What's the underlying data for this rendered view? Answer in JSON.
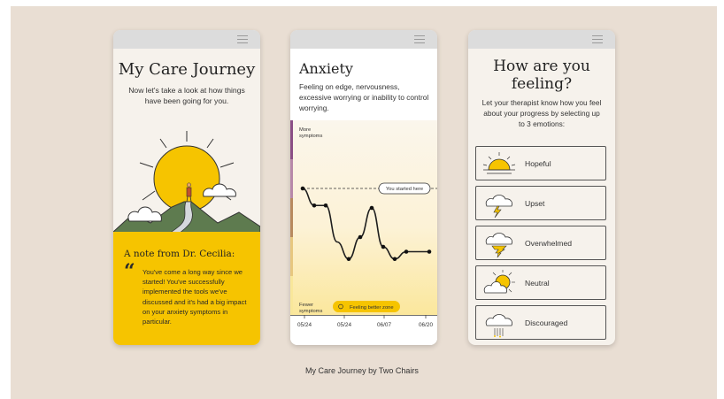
{
  "screen1": {
    "title": "My Care Journey",
    "subtitle": "Now let's take a look at how things have been going for you.",
    "note_title": "A note from Dr. Cecilia:",
    "note_body": "You've come a long way since we started! You've successfully implemented the tools we've discussed and it's had a big impact on your anxiety symptoms in particular.",
    "quote_mark": "“"
  },
  "screen2": {
    "title": "Anxiety",
    "subtitle": "Feeling on edge, nervousness, excessive worrying or inability to control worrying.",
    "more_label": "More symptoms",
    "fewer_label": "Fewer symptoms",
    "started_label": "You started here",
    "zone_label": "Feeling better zone"
  },
  "chart_data": {
    "type": "line",
    "x_ticks": [
      "05/24",
      "05/24",
      "06/07",
      "06/20"
    ],
    "values": [
      3.6,
      3.25,
      3.25,
      2.5,
      2.15,
      2.6,
      3.2,
      2.4,
      2.15,
      2.3,
      2.3,
      2.3
    ],
    "ylim": [
      1,
      5
    ],
    "start_value": 3.6,
    "bands": [
      "#8b4f86",
      "#b889a9",
      "#b88a5e",
      "#e7c77f",
      "#f9e79a"
    ],
    "title": "Anxiety",
    "xlabel": "",
    "ylabel": ""
  },
  "screen3": {
    "title": "How are you feeling?",
    "subtitle": "Let your therapist know how you feel about your progress by selecting up to 3 emotions:",
    "emotions": [
      {
        "label": "Hopeful",
        "icon": "sunrise-icon"
      },
      {
        "label": "Upset",
        "icon": "storm-cloud-icon"
      },
      {
        "label": "Overwhelmed",
        "icon": "tornado-cloud-icon"
      },
      {
        "label": "Neutral",
        "icon": "sun-cloud-icon"
      },
      {
        "label": "Discouraged",
        "icon": "rain-cloud-icon"
      }
    ]
  },
  "caption": "My Care Journey by Two Chairs",
  "colors": {
    "yellow": "#f6c400",
    "green": "#5e7b4f",
    "bg": "#e9ded3"
  }
}
